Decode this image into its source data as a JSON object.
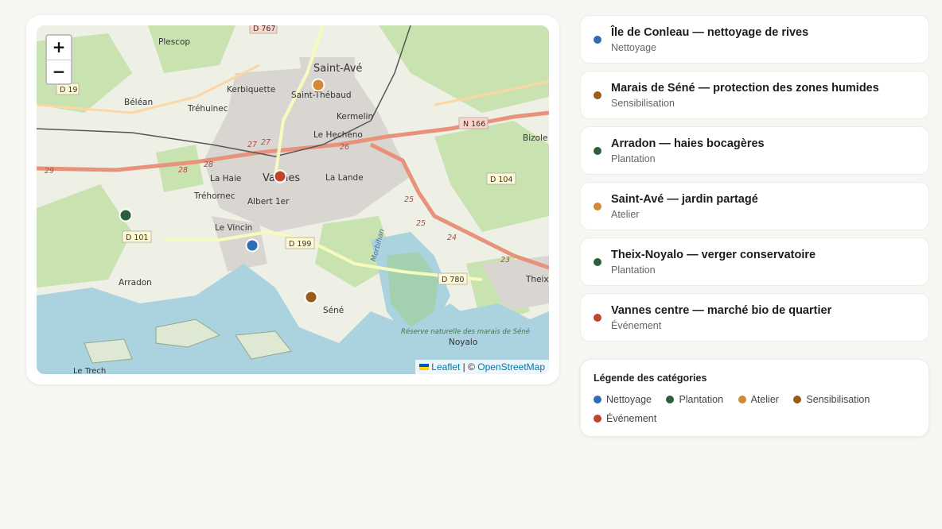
{
  "colors": {
    "Nettoyage": "#2f6db4",
    "Plantation": "#2f5f3a",
    "Atelier": "#d08a36",
    "Sensibilisation": "#9a5a1a",
    "Événement": "#c0442e"
  },
  "map": {
    "zoom_in": "+",
    "zoom_out": "−",
    "attribution": {
      "leaflet": "Leaflet",
      "separator": "| ©",
      "osm": "OpenStreetMap"
    },
    "places": [
      "Plescop",
      "Saint-Avé",
      "Kerbiquette",
      "Saint-Thébaud",
      "Béléan",
      "Tréhuinec",
      "Kermelin",
      "Le Hecheno",
      "La Haie",
      "Vannes",
      "La Lande",
      "Tréhornec",
      "Albert 1er",
      "Le Vincin",
      "Arradon",
      "Séné",
      "Noyalo",
      "Theix",
      "Bizole",
      "Réserve naturelle des marais de Séné",
      "Le Trech",
      "Morbihan"
    ],
    "roads": [
      "D 19",
      "D 767",
      "N 166",
      "D 104",
      "D 101",
      "D 199",
      "D 780"
    ],
    "road_numbers": [
      "29",
      "28",
      "28",
      "27",
      "27",
      "26",
      "25",
      "25",
      "24",
      "23"
    ],
    "markers": [
      {
        "label": "Saint-Avé",
        "category": "Atelier"
      },
      {
        "label": "Vannes centre",
        "category": "Événement"
      },
      {
        "label": "Arradon",
        "category": "Plantation"
      },
      {
        "label": "Île de Conleau",
        "category": "Nettoyage"
      },
      {
        "label": "Marais de Séné",
        "category": "Sensibilisation"
      }
    ]
  },
  "actions": [
    {
      "title": "Île de Conleau — nettoyage de rives",
      "category": "Nettoyage",
      "color": "#2f6db4"
    },
    {
      "title": "Marais de Séné — protection des zones humides",
      "category": "Sensibilisation",
      "color": "#9a5a1a"
    },
    {
      "title": "Arradon — haies bocagères",
      "category": "Plantation",
      "color": "#2f5f3a"
    },
    {
      "title": "Saint-Avé — jardin partagé",
      "category": "Atelier",
      "color": "#d08a36"
    },
    {
      "title": "Theix-Noyalo — verger conservatoire",
      "category": "Plantation",
      "color": "#2f5f3a"
    },
    {
      "title": "Vannes centre — marché bio de quartier",
      "category": "Événement",
      "color": "#c0442e"
    }
  ],
  "legend": {
    "title": "Légende des catégories",
    "entries": [
      {
        "label": "Nettoyage",
        "color": "#2f6db4"
      },
      {
        "label": "Plantation",
        "color": "#2f5f3a"
      },
      {
        "label": "Atelier",
        "color": "#d08a36"
      },
      {
        "label": "Sensibilisation",
        "color": "#9a5a1a"
      },
      {
        "label": "Événement",
        "color": "#c0442e"
      }
    ]
  }
}
